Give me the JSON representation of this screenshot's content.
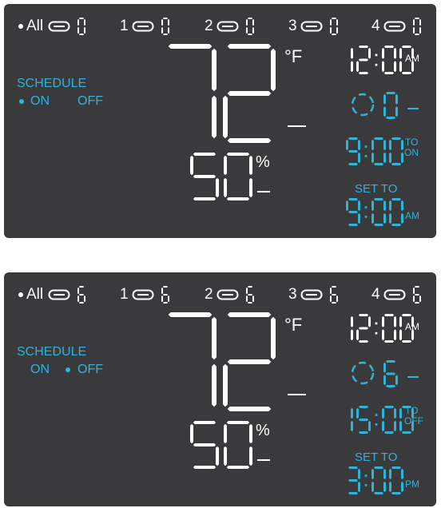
{
  "panels": [
    {
      "zones": [
        {
          "label": "All",
          "selected": true,
          "digit": "0"
        },
        {
          "label": "1",
          "selected": false,
          "digit": "0"
        },
        {
          "label": "2",
          "selected": false,
          "digit": "0"
        },
        {
          "label": "3",
          "selected": false,
          "digit": "0"
        },
        {
          "label": "4",
          "selected": false,
          "digit": "0"
        }
      ],
      "schedule": {
        "label": "SCHEDULE",
        "on_label": "ON",
        "off_label": "OFF",
        "active": "on"
      },
      "temperature": {
        "value": "72",
        "unit": "°F"
      },
      "humidity": {
        "value": "50",
        "unit": "%"
      },
      "clock": {
        "time": "12:00",
        "meridiem": "AM"
      },
      "timer": {
        "count": "0"
      },
      "schedule_time": {
        "time": "9:00",
        "to_label": "TO",
        "state_label": "ON"
      },
      "set_to": {
        "label": "SET TO",
        "time": "9:00",
        "meridiem": "AM"
      }
    },
    {
      "zones": [
        {
          "label": "All",
          "selected": true,
          "digit": "6"
        },
        {
          "label": "1",
          "selected": false,
          "digit": "6"
        },
        {
          "label": "2",
          "selected": false,
          "digit": "6"
        },
        {
          "label": "3",
          "selected": false,
          "digit": "6"
        },
        {
          "label": "4",
          "selected": false,
          "digit": "6"
        }
      ],
      "schedule": {
        "label": "SCHEDULE",
        "on_label": "ON",
        "off_label": "OFF",
        "active": "off"
      },
      "temperature": {
        "value": "72",
        "unit": "°F"
      },
      "humidity": {
        "value": "50",
        "unit": "%"
      },
      "clock": {
        "time": "12:00",
        "meridiem": "AM"
      },
      "timer": {
        "count": "6"
      },
      "schedule_time": {
        "time": "15:00",
        "to_label": "TO",
        "state_label": "OFF"
      },
      "set_to": {
        "label": "SET TO",
        "time": "3:00",
        "meridiem": "PM"
      }
    }
  ],
  "colors": {
    "panel": "#3a3a3c",
    "white": "#ffffff",
    "cyan": "#2fb4d8"
  }
}
